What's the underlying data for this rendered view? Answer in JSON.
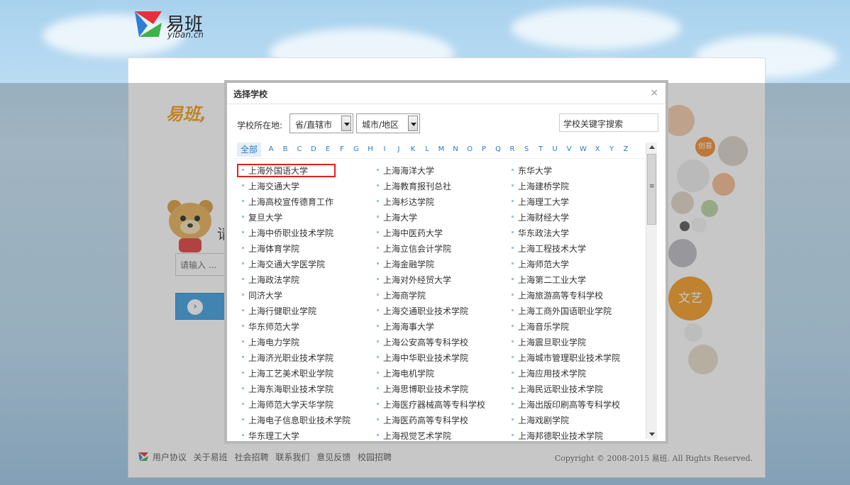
{
  "header": {
    "logo_cn": "易班",
    "logo_en": "yiban.cn"
  },
  "page": {
    "welcome": "易班,",
    "prompt_char": "请",
    "input_placeholder": "请输入 ..."
  },
  "bubbles": {
    "chuangyi": "创意",
    "wenyi": "文艺"
  },
  "footer": {
    "links": [
      "用户协议",
      "关于易班",
      "社会招聘",
      "联系我们",
      "意见反馈",
      "校园招聘"
    ],
    "copyright": "Copyright © 2008-2015 易班. All Rights Reserved."
  },
  "dialog": {
    "title": "选择学校",
    "close": "×",
    "location_label": "学校所在地:",
    "province_select": "省/直辖市",
    "city_select": "城市/地区",
    "search_placeholder": "学校关键字搜索",
    "letters": [
      "全部",
      "A",
      "B",
      "C",
      "D",
      "E",
      "F",
      "G",
      "H",
      "I",
      "J",
      "K",
      "L",
      "M",
      "N",
      "O",
      "P",
      "Q",
      "R",
      "S",
      "T",
      "U",
      "V",
      "W",
      "X",
      "Y",
      "Z"
    ],
    "schools": [
      [
        "上海外国语大学",
        "上海海洋大学",
        "东华大学"
      ],
      [
        "上海交通大学",
        "上海教育报刊总社",
        "上海建桥学院"
      ],
      [
        "上海高校宣传德育工作",
        "上海杉达学院",
        "上海理工大学"
      ],
      [
        "复旦大学",
        "上海大学",
        "上海财经大学"
      ],
      [
        "上海中侨职业技术学院",
        "上海中医药大学",
        "华东政法大学"
      ],
      [
        "上海体育学院",
        "上海立信会计学院",
        "上海工程技术大学"
      ],
      [
        "上海交通大学医学院",
        "上海金融学院",
        "上海师范大学"
      ],
      [
        "上海政法学院",
        "上海对外经贸大学",
        "上海第二工业大学"
      ],
      [
        "同济大学",
        "上海商学院",
        "上海旅游高等专科学校"
      ],
      [
        "上海行健职业学院",
        "上海交通职业技术学院",
        "上海工商外国语职业学院"
      ],
      [
        "华东师范大学",
        "上海海事大学",
        "上海音乐学院"
      ],
      [
        "上海电力学院",
        "上海公安高等专科学校",
        "上海震旦职业学院"
      ],
      [
        "上海济光职业技术学院",
        "上海中华职业技术学院",
        "上海城市管理职业技术学院"
      ],
      [
        "上海工艺美术职业学院",
        "上海电机学院",
        "上海应用技术学院"
      ],
      [
        "上海东海职业技术学院",
        "上海思博职业技术学院",
        "上海民远职业技术学院"
      ],
      [
        "上海师范大学天华学院",
        "上海医疗器械高等专科学校",
        "上海出版印刷高等专科学校"
      ],
      [
        "上海电子信息职业技术学院",
        "上海医药高等专科学校",
        "上海戏剧学院"
      ],
      [
        "华东理工大学",
        "上海视觉艺术学院",
        "上海邦德职业技术学院"
      ]
    ]
  }
}
